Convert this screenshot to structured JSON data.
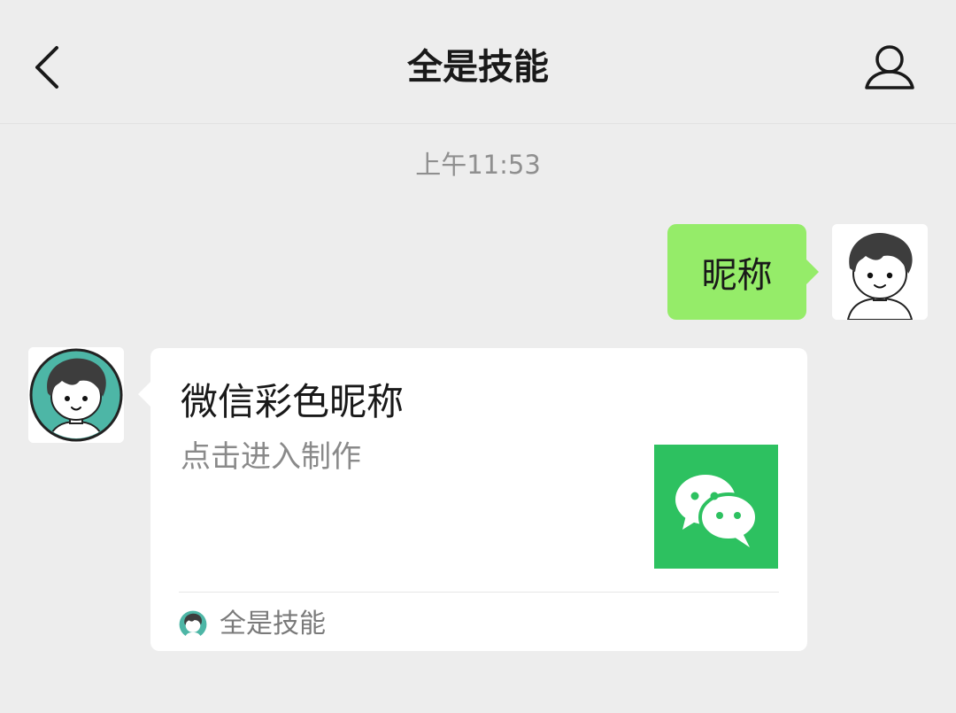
{
  "nav": {
    "title": "全是技能",
    "back_icon": "chevron-left-icon",
    "profile_icon": "person-icon"
  },
  "chat": {
    "timestamp": "上午11:53",
    "my_message": "昵称",
    "card": {
      "title": "微信彩色昵称",
      "description": "点击进入制作",
      "thumb_icon": "wechat-chat-icon",
      "source_name": "全是技能"
    }
  },
  "colors": {
    "background": "#ededed",
    "my_bubble": "#95ec69",
    "thumb": "#2dc160",
    "avatar_teal": "#4db6a6"
  }
}
